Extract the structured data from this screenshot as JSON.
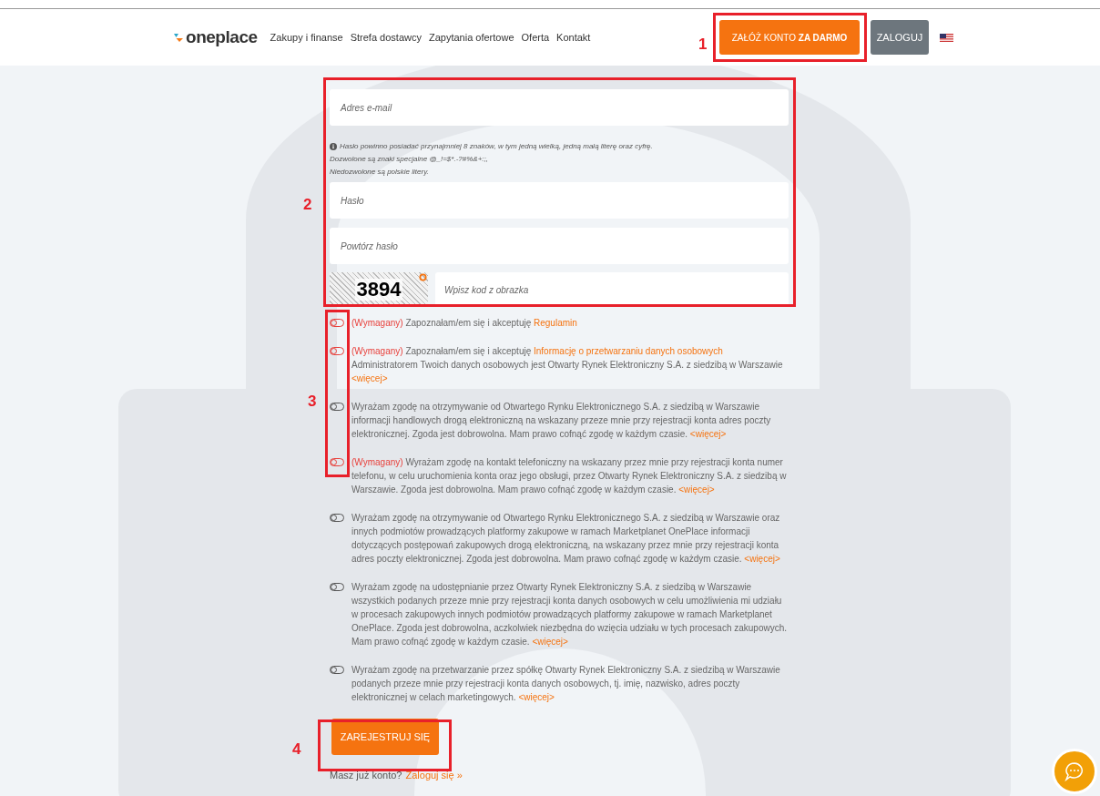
{
  "header": {
    "logo": "oneplace",
    "nav": [
      {
        "label": "Zakupy i finanse"
      },
      {
        "label": "Strefa dostawcy"
      },
      {
        "label": "Zapytania ofertowe"
      },
      {
        "label": "Oferta"
      },
      {
        "label": "Kontakt"
      }
    ],
    "signup_button": "ZAŁÓŻ KONTO **ZA DARMO**",
    "login_button": "ZALOGUJ"
  },
  "form": {
    "email": {
      "placeholder": "Adres e-mail"
    },
    "password_hint": [
      "Hasło powinno posiadać przynajmniej 8 znaków, w tym jedną wielką, jedną małą literę oraz cyfrę.",
      "Dozwolone są znaki specjalne @_!=$*.-?#%&+:;,",
      "Niedozwolone są polskie litery."
    ],
    "password": {
      "placeholder": "Hasło"
    },
    "repeat_password": {
      "placeholder": "Powtórz hasło"
    },
    "captcha": {
      "image_text": "3894",
      "placeholder": "Wpisz kod z obrazka"
    },
    "consents": [
      {
        "checked": false,
        "parts": [
          {
            "kind": "required",
            "text": "(Wymagany)"
          },
          {
            "kind": "plain",
            "text": "Zapoznałam/em się i akceptuję"
          },
          {
            "kind": "link",
            "text": "Regulamin"
          }
        ]
      },
      {
        "checked": false,
        "parts": [
          {
            "kind": "required",
            "text": "(Wymagany)"
          },
          {
            "kind": "plain",
            "text": "Zapoznałam/em się i akceptuję"
          },
          {
            "kind": "link",
            "text": "Informację o przetwarzaniu danych osobowych"
          },
          {
            "kind": "break"
          },
          {
            "kind": "plain",
            "text": "Administratorem Twoich danych osobowych jest Otwarty Rynek Elektroniczny S.A. z siedzibą w Warszawie"
          },
          {
            "kind": "link",
            "text": "<więcej>"
          }
        ]
      },
      {
        "checked": false,
        "parts": [
          {
            "kind": "plain",
            "text": "Wyrażam zgodę na otrzymywanie od Otwartego Rynku Elektronicznego S.A. z siedzibą w Warszawie informacji handlowych drogą elektroniczną na wskazany przeze mnie przy rejestracji konta adres poczty elektronicznej. Zgoda jest dobrowolna. Mam prawo cofnąć zgodę w każdym czasie."
          },
          {
            "kind": "link",
            "text": "<więcej>"
          }
        ]
      },
      {
        "checked": false,
        "parts": [
          {
            "kind": "required",
            "text": "(Wymagany)"
          },
          {
            "kind": "plain",
            "text": "Wyrażam zgodę na kontakt telefoniczny na wskazany przez mnie przy rejestracji konta numer telefonu, w celu uruchomienia konta oraz jego obsługi, przez Otwarty Rynek Elektroniczny S.A. z siedzibą w Warszawie. Zgoda jest dobrowolna. Mam prawo cofnąć zgodę w każdym czasie."
          },
          {
            "kind": "link",
            "text": "<więcej>"
          }
        ]
      },
      {
        "checked": false,
        "parts": [
          {
            "kind": "plain",
            "text": "Wyrażam zgodę na otrzymywanie od Otwartego Rynku Elektronicznego S.A. z siedzibą w Warszawie oraz innych podmiotów prowadzących platformy zakupowe w ramach Marketplanet OnePlace informacji dotyczących postępowań zakupowych drogą elektroniczną, na wskazany przez mnie przy rejestracji konta adres poczty elektronicznej. Zgoda jest dobrowolna. Mam prawo cofnąć zgodę w każdym czasie."
          },
          {
            "kind": "link",
            "text": "<więcej>"
          }
        ]
      },
      {
        "checked": false,
        "parts": [
          {
            "kind": "plain",
            "text": "Wyrażam zgodę na udostępnianie przez Otwarty Rynek Elektroniczny S.A. z siedzibą w Warszawie wszystkich podanych przeze mnie przy rejestracji konta danych osobowych w celu umożliwienia mi udziału w procesach zakupowych innych podmiotów prowadzących platformy zakupowe w ramach Marketplanet OnePlace. Zgoda jest dobrowolna, aczkolwiek niezbędna do wzięcia udziału w tych procesach zakupowych. Mam prawo cofnąć zgodę w każdym czasie."
          },
          {
            "kind": "link",
            "text": "<więcej>"
          }
        ]
      },
      {
        "checked": false,
        "parts": [
          {
            "kind": "plain",
            "text": "Wyrażam zgodę na przetwarzanie przez spółkę Otwarty Rynek Elektroniczny S.A. z siedzibą w Warszawie podanych przeze mnie przy rejestracji konta danych osobowych, tj. imię, nazwisko, adres poczty elektronicznej w celach marketingowych."
          },
          {
            "kind": "link",
            "text": "<więcej>"
          }
        ]
      }
    ],
    "register_button": "ZAREJESTRUJ SIĘ",
    "have_account": "Masz już konto?",
    "login_link": "Zaloguj się »"
  },
  "annotations": [
    {
      "label": "1"
    },
    {
      "label": "2"
    },
    {
      "label": "3"
    },
    {
      "label": "4"
    }
  ]
}
